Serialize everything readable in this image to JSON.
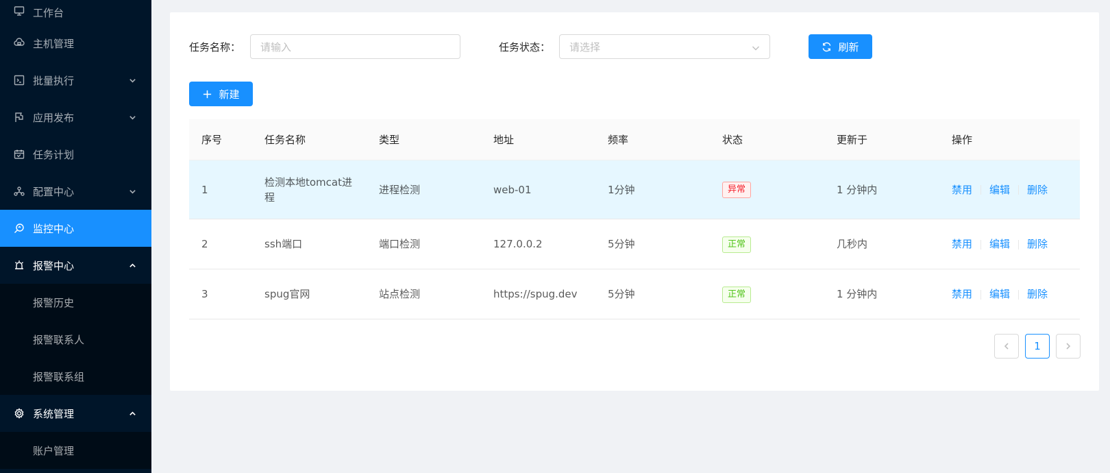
{
  "sidebar": {
    "items": [
      {
        "label": "工作台",
        "icon": "desktop-icon"
      },
      {
        "label": "主机管理",
        "icon": "cloud-server-icon"
      },
      {
        "label": "批量执行",
        "icon": "code-icon",
        "arrow": "chevron-down-icon"
      },
      {
        "label": "应用发布",
        "icon": "flag-icon",
        "arrow": "chevron-down-icon"
      },
      {
        "label": "任务计划",
        "icon": "calendar-icon"
      },
      {
        "label": "配置中心",
        "icon": "cluster-icon",
        "arrow": "chevron-down-icon"
      },
      {
        "label": "监控中心",
        "icon": "monitor-search-icon",
        "active": true
      },
      {
        "label": "报警中心",
        "icon": "alarm-icon",
        "arrow": "chevron-up-icon"
      },
      {
        "label": "系统管理",
        "icon": "setting-icon",
        "arrow": "chevron-up-icon"
      }
    ],
    "alarm_sub": [
      "报警历史",
      "报警联系人",
      "报警联系组"
    ],
    "system_sub": [
      "账户管理"
    ]
  },
  "filters": {
    "name_label": "任务名称：",
    "name_placeholder": "请输入",
    "status_label": "任务状态：",
    "status_placeholder": "请选择",
    "refresh_label": "刷新"
  },
  "toolbar": {
    "new_label": "新建"
  },
  "table": {
    "headers": [
      "序号",
      "任务名称",
      "类型",
      "地址",
      "频率",
      "状态",
      "更新于",
      "操作"
    ],
    "rows": [
      {
        "no": "1",
        "name": "检测本地tomcat进程",
        "type": "进程检测",
        "addr": "web-01",
        "freq": "1分钟",
        "status": "异常",
        "updated": "1 分钟内"
      },
      {
        "no": "2",
        "name": "ssh端口",
        "type": "端口检测",
        "addr": "127.0.0.2",
        "freq": "5分钟",
        "status": "正常",
        "updated": "几秒内"
      },
      {
        "no": "3",
        "name": "spug官网",
        "type": "站点检测",
        "addr": "https://spug.dev",
        "freq": "5分钟",
        "status": "正常",
        "updated": "1 分钟内"
      }
    ],
    "actions": [
      "禁用",
      "编辑",
      "删除"
    ]
  },
  "pagination": {
    "current": "1"
  },
  "colors": {
    "primary": "#1890ff",
    "sidebar_bg": "#001529",
    "error": "#f5222d",
    "success": "#52c41a"
  }
}
